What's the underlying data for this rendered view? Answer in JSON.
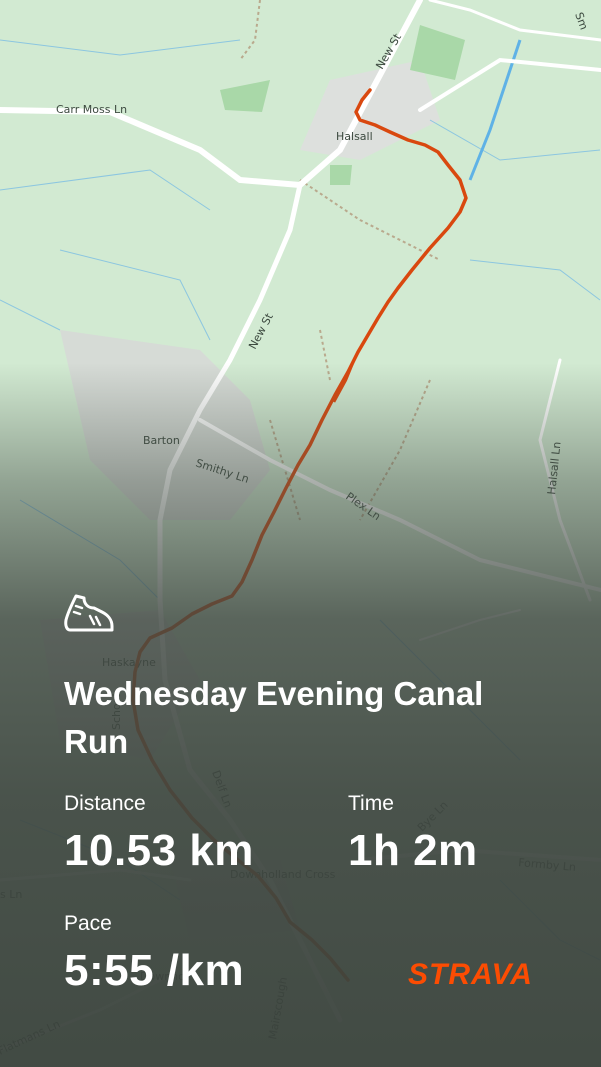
{
  "map": {
    "labels": {
      "carr_moss_ln": "Carr Moss Ln",
      "new_st_north": "New St",
      "halsall": "Halsall",
      "new_st_south": "New St",
      "barton": "Barton",
      "smithy_ln": "Smithy Ln",
      "plex_ln": "Plex Ln",
      "halsall_ln": "Halsall Ln",
      "haskayne": "Haskayne",
      "school_ln": "School",
      "delf_ln": "Delf Ln",
      "bye_ln": "Bye Ln",
      "formby_ln": "Formby Ln",
      "downholland_cross": "Downholland Cross",
      "downholland": "Downholl",
      "mairscough": "Mairscough",
      "flatmans_ln": "Flatmans Ln",
      "left_edge_ln": "s Ln",
      "top_right": "Sm"
    },
    "colors": {
      "land": "#cfe8cf",
      "road": "#ffffff",
      "water": "#6fb7e8",
      "route": "#d9480f"
    }
  },
  "activity": {
    "icon": "running-shoe-icon",
    "title": "Wednesday Evening Canal Run",
    "distance_label": "Distance",
    "distance_value": "10.53 km",
    "time_label": "Time",
    "time_value": "1h 2m",
    "pace_label": "Pace",
    "pace_value": "5:55 /km"
  },
  "brand": {
    "name": "STRAVA",
    "color": "#fc4c02"
  }
}
